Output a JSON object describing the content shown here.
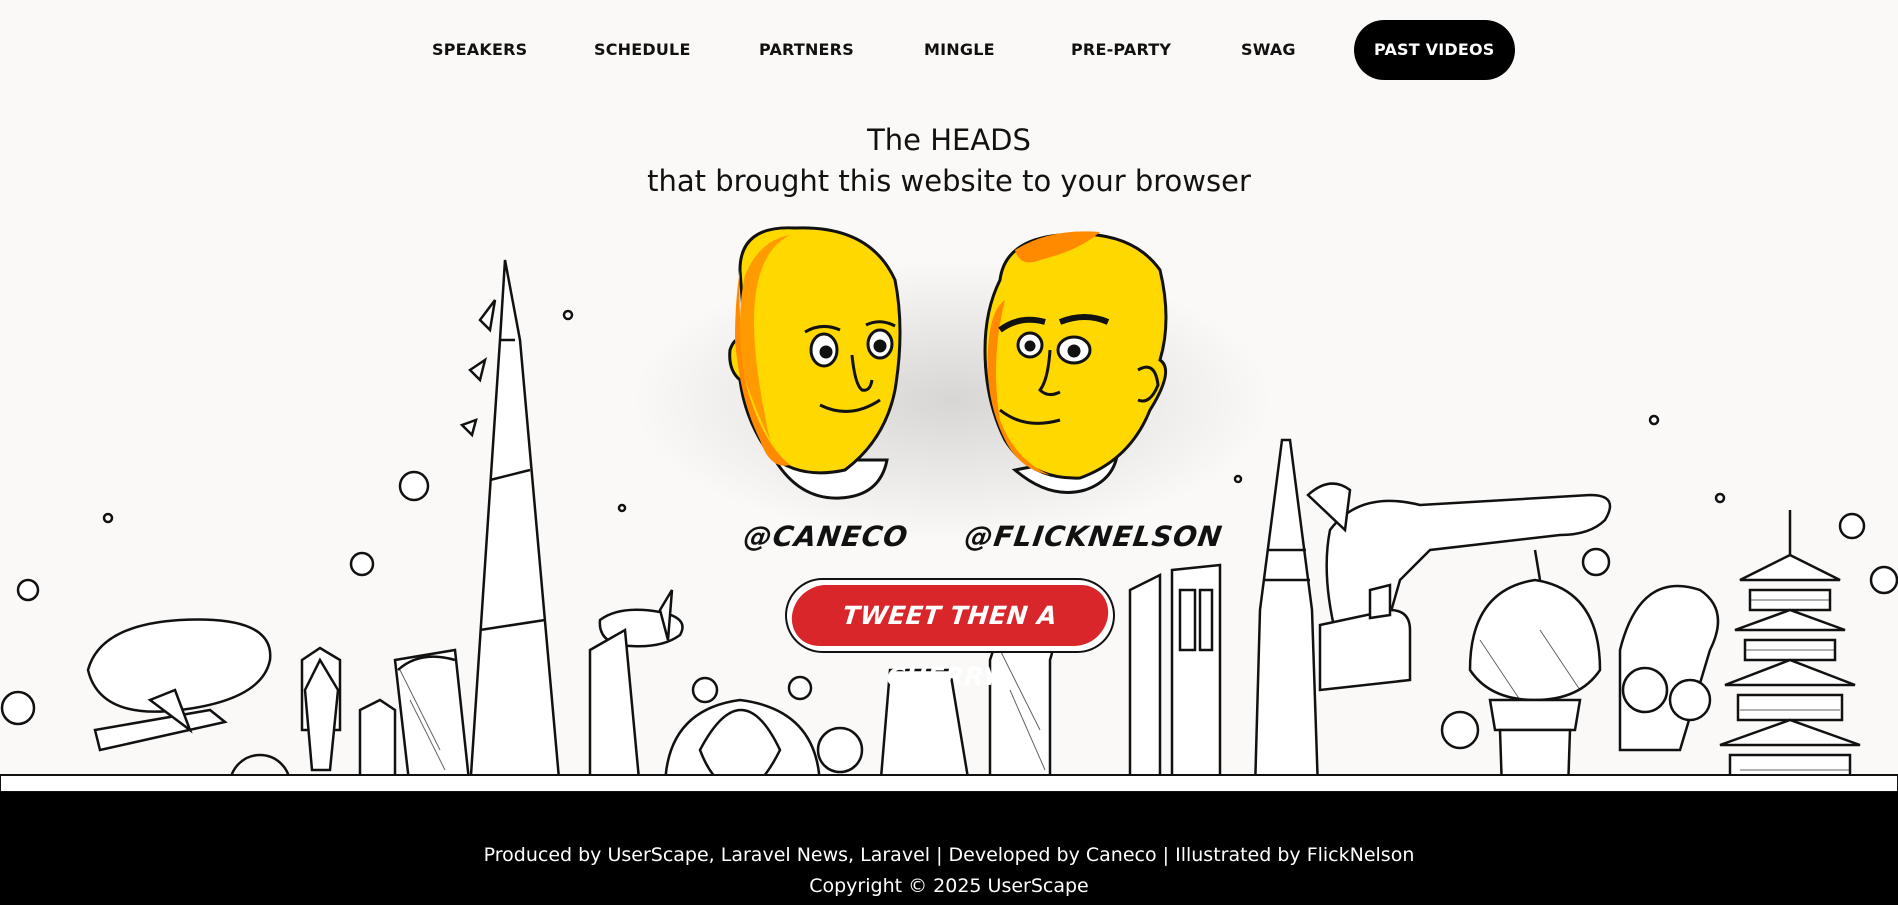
{
  "nav": {
    "items": [
      {
        "label": "SPEAKERS"
      },
      {
        "label": "SCHEDULE"
      },
      {
        "label": "PARTNERS"
      },
      {
        "label": "MINGLE"
      },
      {
        "label": "PRE-PARTY"
      },
      {
        "label": "SWAG"
      },
      {
        "label": "PAST VIDEOS",
        "active": true
      }
    ]
  },
  "heading": {
    "line1": "The HEADS",
    "line2": "that brought this website to your browser"
  },
  "people": [
    {
      "handle": "@caneco"
    },
    {
      "handle": "@flicknelson"
    }
  ],
  "cta": {
    "label": "Tweet then a cherry",
    "color": "#d9262a"
  },
  "footer": {
    "produced_prefix": "Produced by ",
    "userscape": "UserScape",
    "comma1": ", ",
    "laravel_news": "Laravel News",
    "comma2": ", ",
    "laravel": "Laravel",
    "developed_prefix": " | Developed by ",
    "caneco": "Caneco",
    "illustrated_prefix": " | Illustrated by ",
    "flicknelson": "FlickNelson",
    "copyright": "Copyright © 2025 UserScape"
  },
  "colors": {
    "accent": "#d9262a",
    "head_yellow": "#ffd600",
    "head_orange": "#ff8c00",
    "footer_bg": "#000000"
  }
}
